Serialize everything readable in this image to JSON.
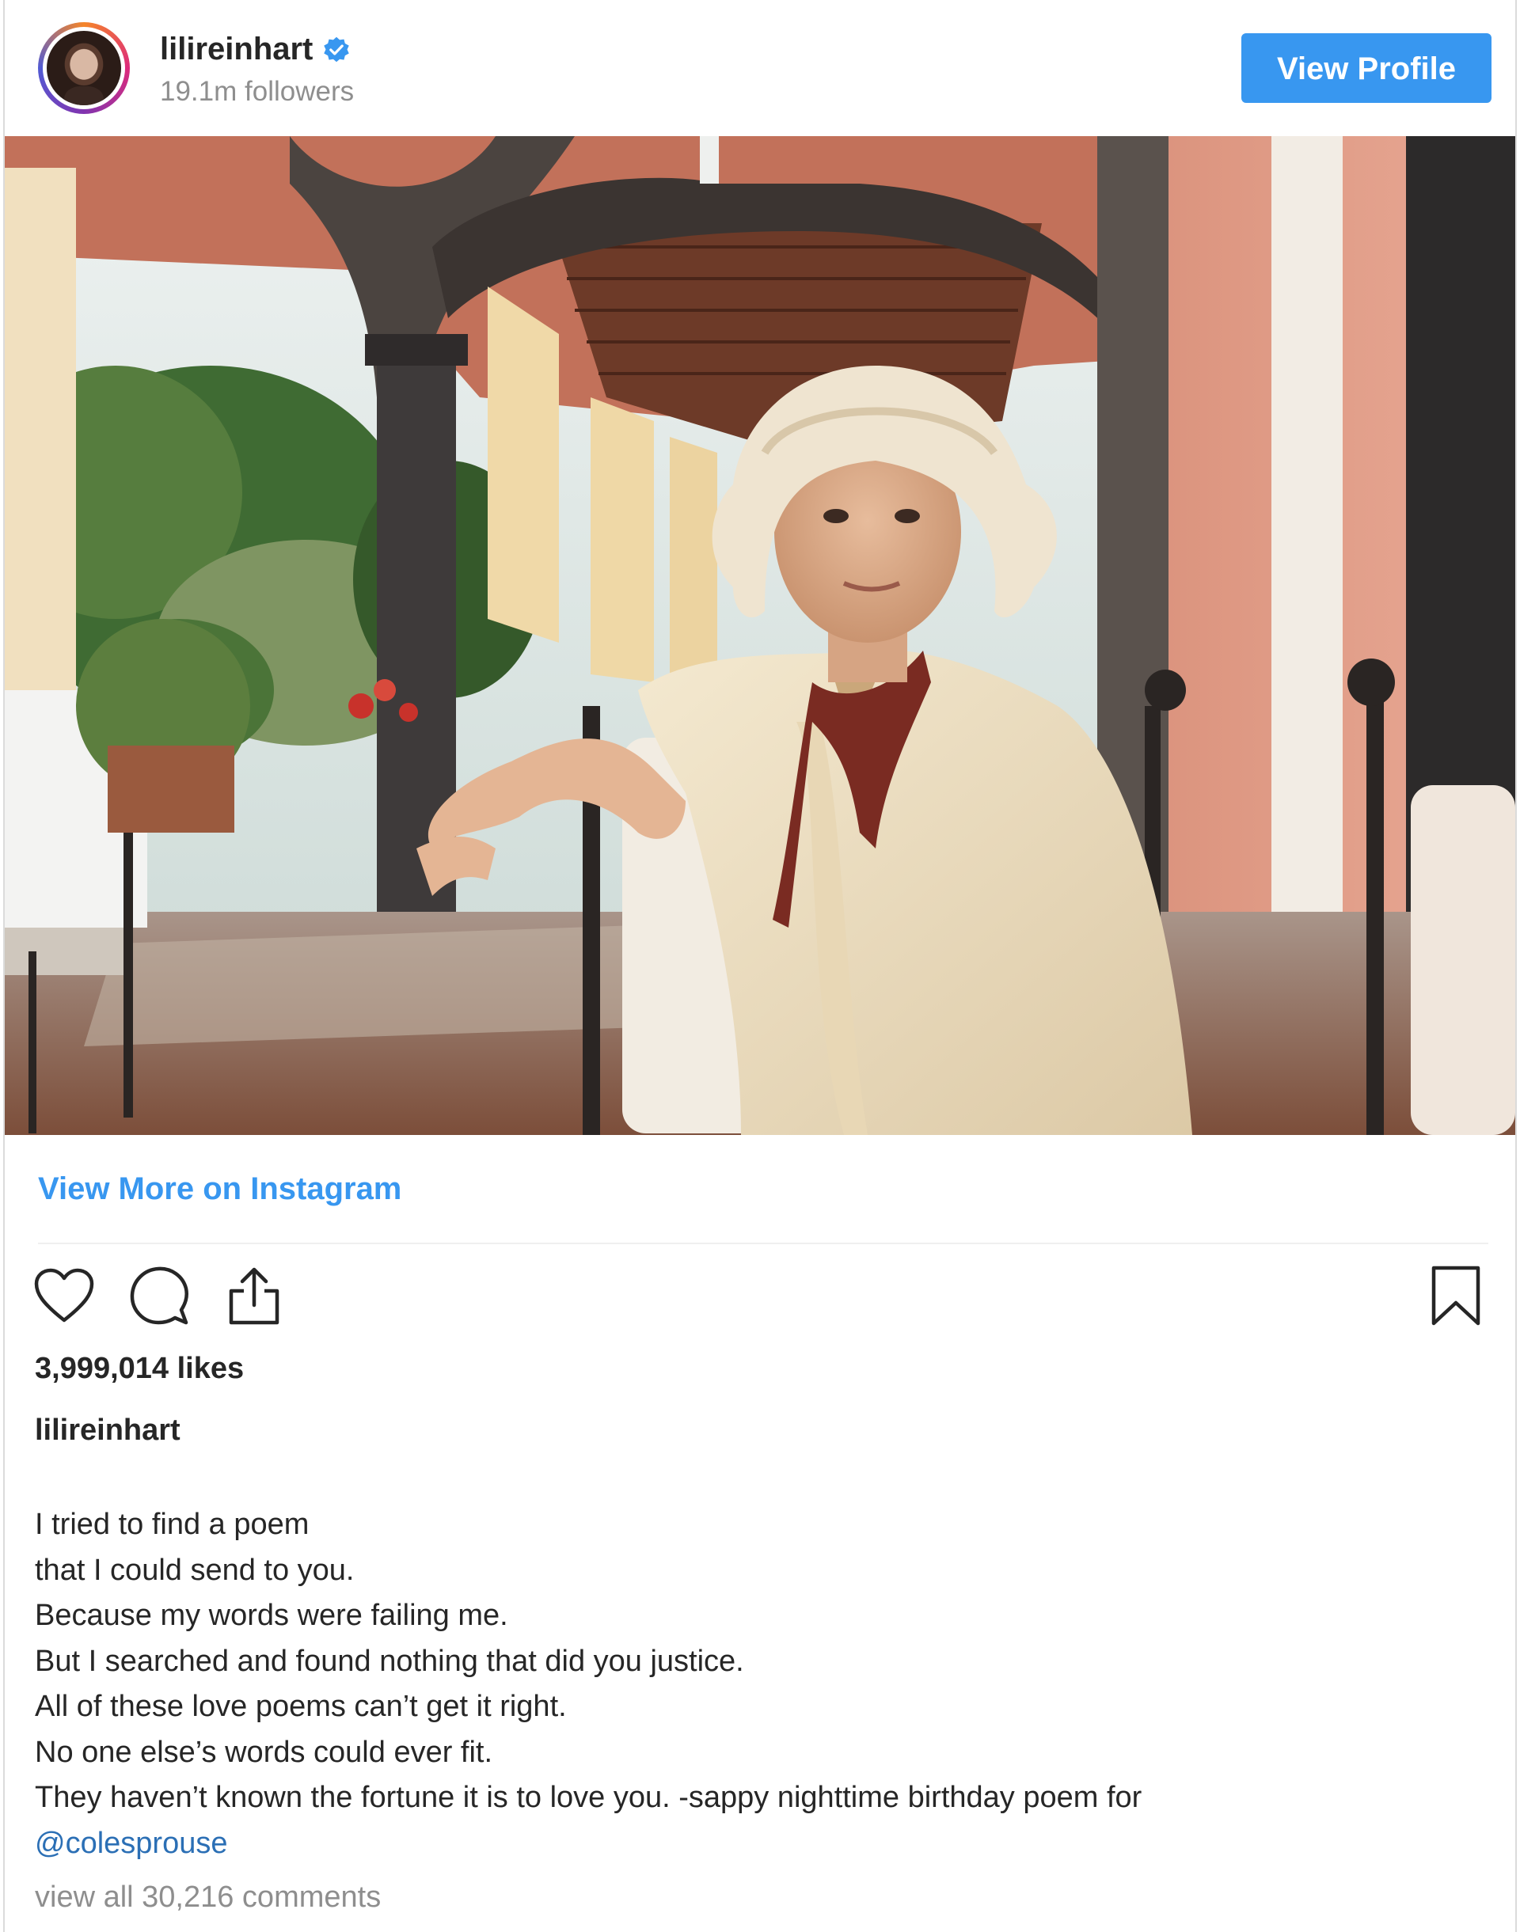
{
  "header": {
    "username": "lilireinhart",
    "followers": "19.1m followers",
    "view_profile_label": "View Profile"
  },
  "post": {
    "view_more_label": "View More on Instagram",
    "likes": "3,999,014 likes",
    "author": "lilireinhart",
    "caption_lines": [
      "I tried to find a poem",
      "that I could send to you.",
      "Because my words were failing me.",
      "But I searched and found nothing that did you justice.",
      "All of these love poems can’t get it right.",
      "No one else’s words could ever fit.",
      "They haven’t known the fortune it is to love you. -sappy nighttime birthday poem for"
    ],
    "mention": "@colesprouse",
    "view_comments": "view all 30,216 comments"
  },
  "icons": {
    "verified": "verified-badge-icon",
    "like": "heart-icon",
    "comment": "comment-bubble-icon",
    "share": "share-icon",
    "save": "bookmark-icon"
  },
  "colors": {
    "accent": "#3897f0",
    "muted": "#8e8e8e",
    "text": "#262626"
  }
}
